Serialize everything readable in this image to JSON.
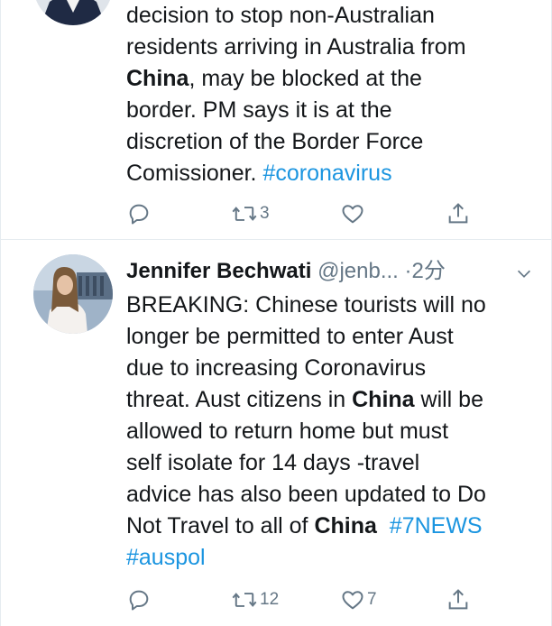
{
  "tweet1": {
    "text_parts": [
      {
        "t": "decision to stop non-Australian\nresidents arriving in Australia from\n",
        "style": "plain"
      },
      {
        "t": "China",
        "style": "bold"
      },
      {
        "t": ", may be blocked at the\nborder. PM says it is at the\ndiscretion of the Border Force\nComissioner. ",
        "style": "plain"
      },
      {
        "t": "#coronavirus",
        "style": "hashtag"
      }
    ],
    "actions": {
      "reply_icon": "reply-icon",
      "retweet_icon": "retweet-icon",
      "retweet_count": "3",
      "like_icon": "heart-icon",
      "like_count": "",
      "share_icon": "share-icon"
    }
  },
  "tweet2": {
    "display_name": "Jennifer Bechwati",
    "handle": "@jenb...",
    "separator": "·",
    "time": "2分",
    "caret_icon": "chevron-down-icon",
    "text_parts": [
      {
        "t": "BREAKING: Chinese tourists will no\nlonger be permitted to enter Aust\ndue to increasing Coronavirus\nthreat. Aust citizens in ",
        "style": "plain"
      },
      {
        "t": "China",
        "style": "bold"
      },
      {
        "t": " will be\nallowed to return home but must\nself isolate for 14 days -travel\nadvice has also been updated to Do\nNot Travel to all of ",
        "style": "plain"
      },
      {
        "t": "China",
        "style": "bold"
      },
      {
        "t": "  ",
        "style": "plain"
      },
      {
        "t": "#7NEWS",
        "style": "hashtag"
      },
      {
        "t": "\n",
        "style": "plain"
      },
      {
        "t": "#auspol",
        "style": "hashtag"
      }
    ],
    "actions": {
      "reply_icon": "reply-icon",
      "retweet_icon": "retweet-icon",
      "retweet_count": "12",
      "like_icon": "heart-icon",
      "like_count": "7",
      "share_icon": "share-icon"
    }
  },
  "colors": {
    "text": "#14171a",
    "secondary": "#657786",
    "link": "#1b95e0",
    "divider": "#e6ecf0"
  }
}
